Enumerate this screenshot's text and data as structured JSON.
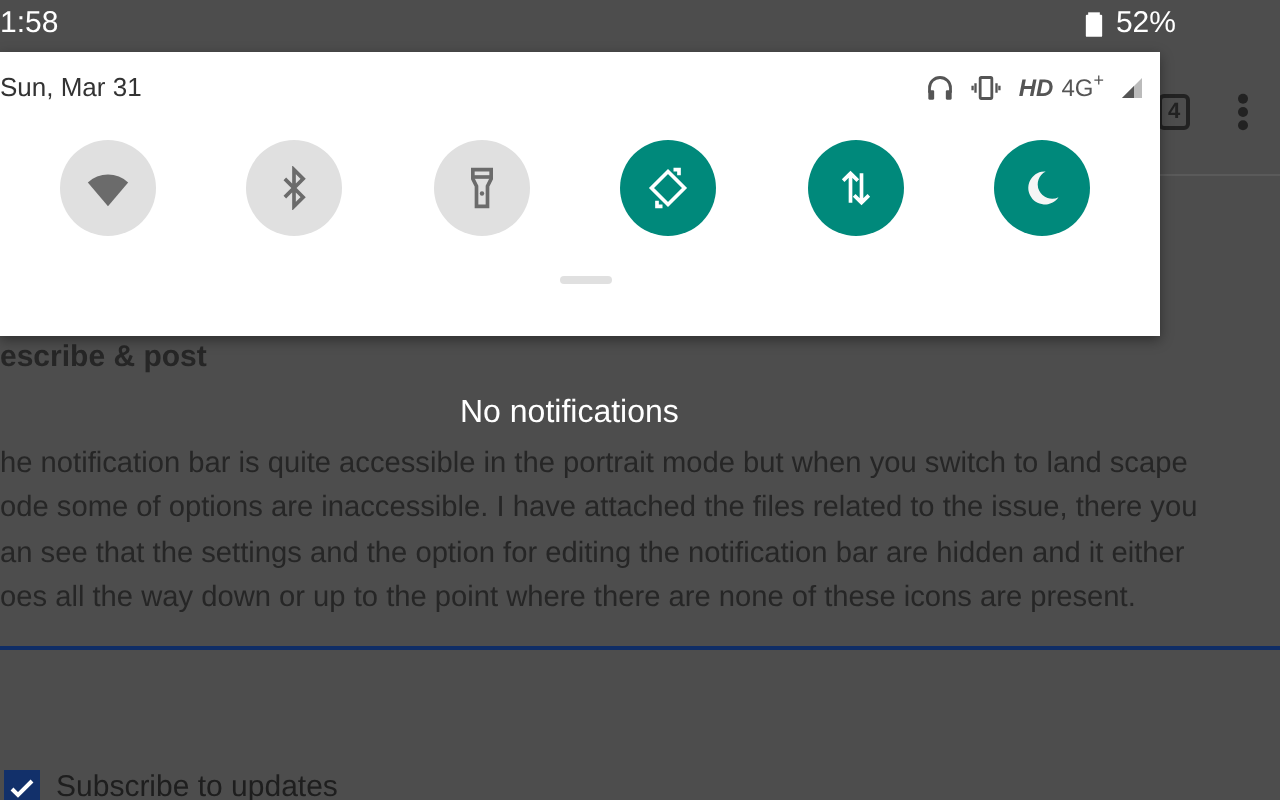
{
  "status_bar": {
    "time": "1:58",
    "battery": "52%"
  },
  "quick_settings": {
    "date": "Sun, Mar 31",
    "network_hd": "HD",
    "network_type": "4G$^{+}$",
    "tiles": [
      {
        "kind": "wifi",
        "on": false
      },
      {
        "kind": "bluetooth",
        "on": false
      },
      {
        "kind": "flashlight",
        "on": false
      },
      {
        "kind": "rotate",
        "on": true
      },
      {
        "kind": "data",
        "on": true
      },
      {
        "kind": "moon",
        "on": true
      }
    ]
  },
  "notifications": {
    "empty_text": "No notifications"
  },
  "page": {
    "toolbar_badge": "4",
    "heading": "escribe & post",
    "description_lines": [
      "he notification bar is quite accessible in the portrait mode but when you switch to land scape",
      "ode some of options are inaccessible. I have attached the files related to the issue, there you",
      "an see that the settings and the option for editing the notification bar are hidden and it either",
      "oes all the way down or up to the point where there are none of these icons are present."
    ],
    "subscribe": {
      "label": "Subscribe to updates",
      "checked": true
    }
  }
}
